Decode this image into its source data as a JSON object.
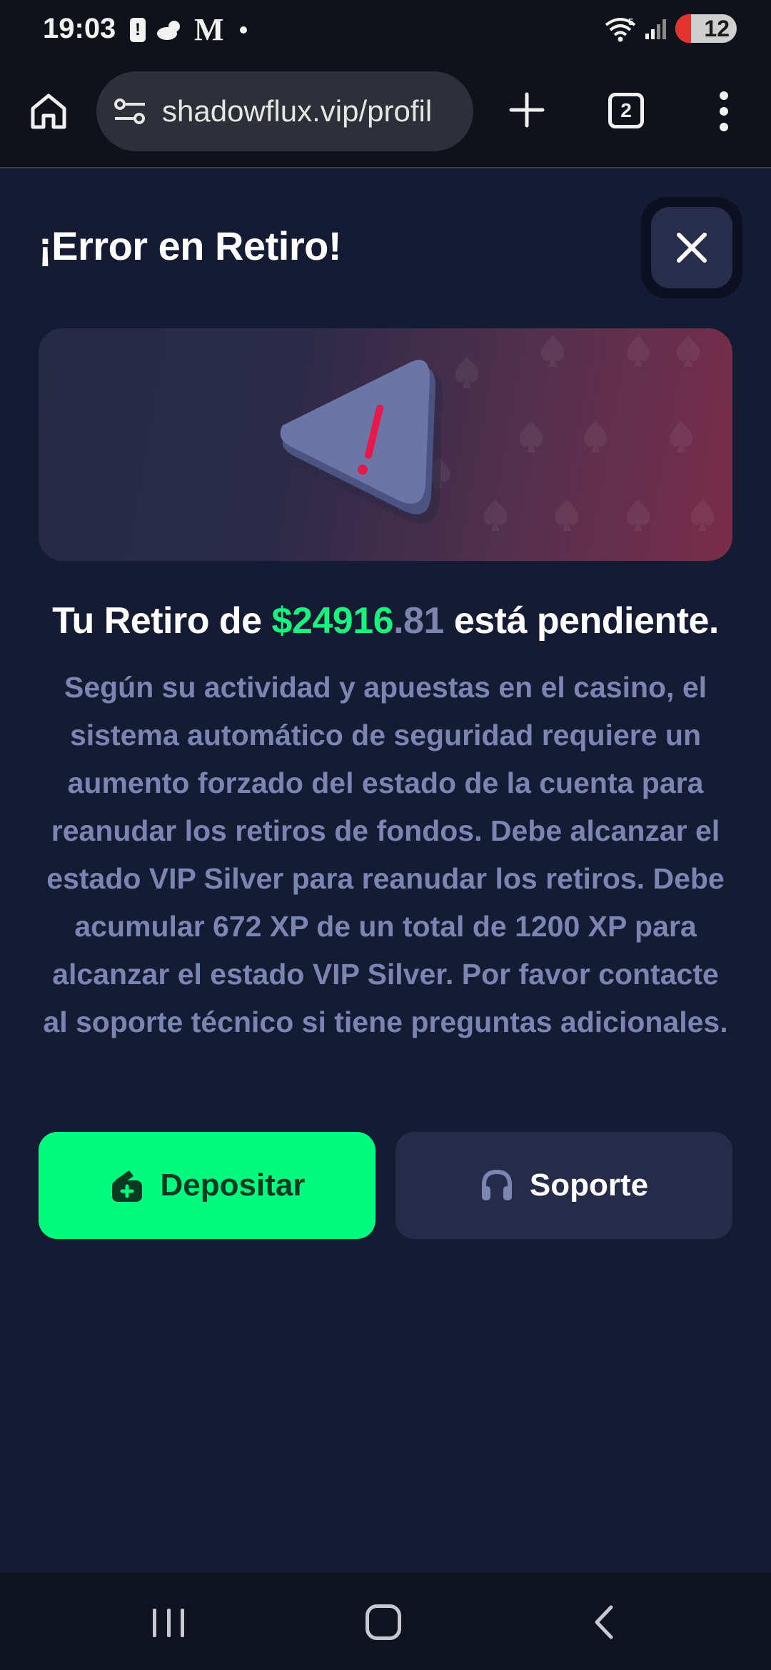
{
  "status_bar": {
    "time": "19:03",
    "battery_level": "12",
    "battery_level_fraction": 0.12,
    "network": "5"
  },
  "browser": {
    "url": "shadowflux.vip/profil",
    "tab_count": "2"
  },
  "modal": {
    "title": "¡Error en Retiro!",
    "headline_prefix": "Tu Retiro de ",
    "amount_main": "$24916",
    "amount_cents": ".81",
    "headline_suffix": " está pendiente.",
    "message": "Según su actividad y apuestas en el casino, el sistema automático de seguridad requiere un aumento forzado del estado de la cuenta para reanudar los retiros de fondos. Debe alcanzar el estado VIP Silver para reanudar los retiros. Debe acumular 672 XP de un total de 1200 XP para alcanzar el estado VIP Silver. Por favor contacte al soporte técnico si tiene preguntas adicionales.",
    "deposit_label": "Depositar",
    "support_label": "Soporte"
  },
  "icons": [
    "home-icon",
    "tune-icon",
    "plus-icon",
    "tabs-icon",
    "more-vert-icon",
    "close-icon",
    "warning-icon",
    "wallet-icon",
    "headset-icon"
  ],
  "colors": {
    "background": "#151b33",
    "accent_green": "#00fb7f",
    "amount_green": "#19f27c",
    "body_text": "#7c84b2",
    "secondary_button": "#252b48",
    "warning_red": "#e8194a"
  }
}
